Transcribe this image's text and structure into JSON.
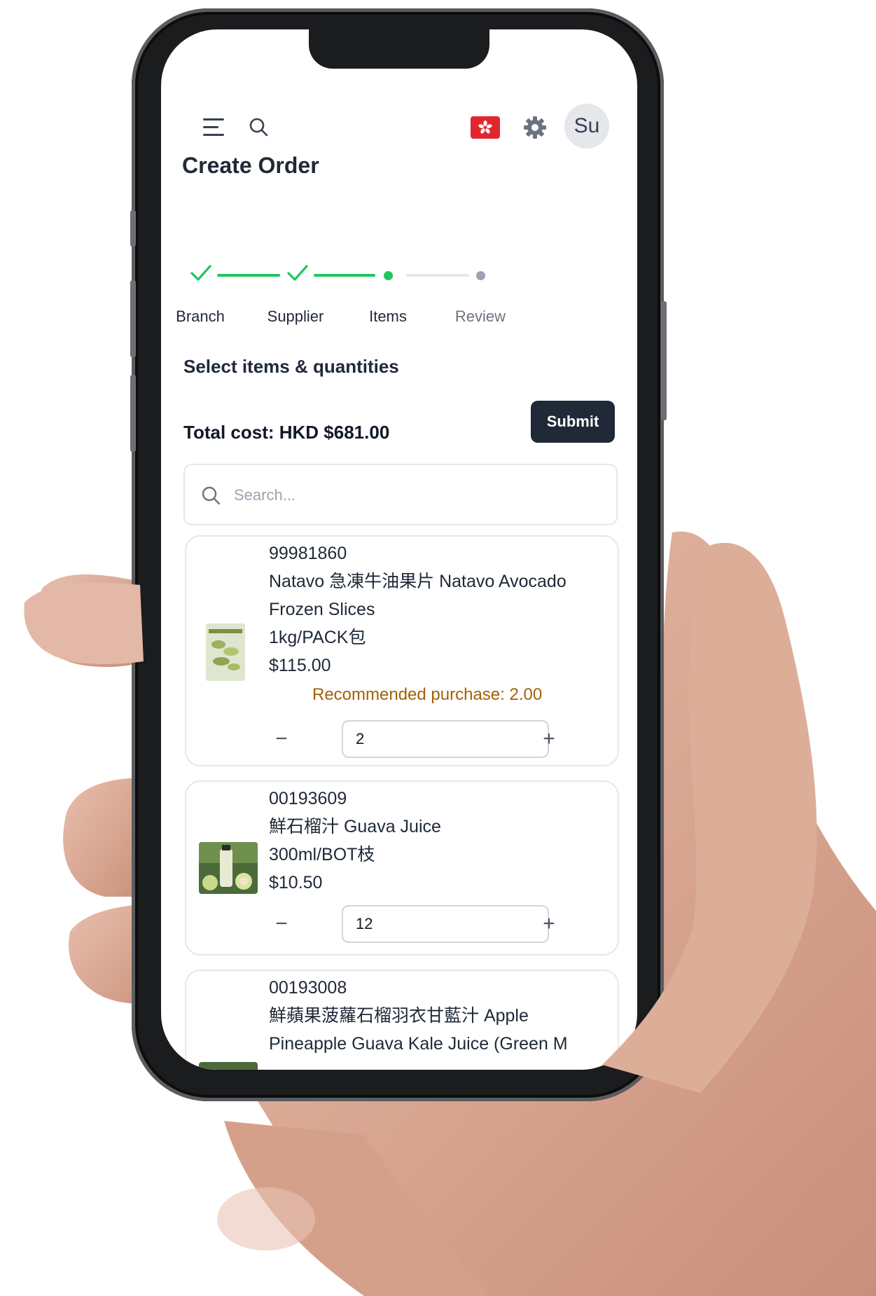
{
  "header": {
    "menu_icon": "menu-icon",
    "search_icon": "search-icon",
    "language_flag_icon": "hong-kong-flag-icon",
    "settings_icon": "gear-icon",
    "avatar_initials": "Su"
  },
  "page": {
    "title": "Create Order"
  },
  "stepper": {
    "steps": [
      {
        "label": "Branch",
        "status": "complete"
      },
      {
        "label": "Supplier",
        "status": "complete"
      },
      {
        "label": "Items",
        "status": "current"
      },
      {
        "label": "Review",
        "status": "upcoming"
      }
    ]
  },
  "items_section": {
    "title": "Select items & quantities",
    "total_cost": "Total cost: HKD $681.00",
    "submit_label": "Submit",
    "search_placeholder": "Search..."
  },
  "items": [
    {
      "code": "99981860",
      "name_line1": "Natavo 急凍牛油果片 Natavo Avocado",
      "name_line2": "Frozen Slices",
      "unit": "1kg/PACK包",
      "price": "$115.00",
      "recommendation": "Recommended purchase: 2.00",
      "quantity": "2"
    },
    {
      "code": "00193609",
      "name_line1": "鮮石榴汁 Guava Juice",
      "unit": "300ml/BOT枝",
      "price": "$10.50",
      "quantity": "12"
    },
    {
      "code": "00193008",
      "name_line1": "鮮蘋果菠蘿石榴羽衣甘藍汁 Apple",
      "name_line2": "Pineapple Guava Kale Juice (Green M"
    }
  ],
  "colors": {
    "accent_green": "#22c55e",
    "dark_button": "#1f2937",
    "recommend_text": "#a16207",
    "flag_red": "#e2262f"
  }
}
